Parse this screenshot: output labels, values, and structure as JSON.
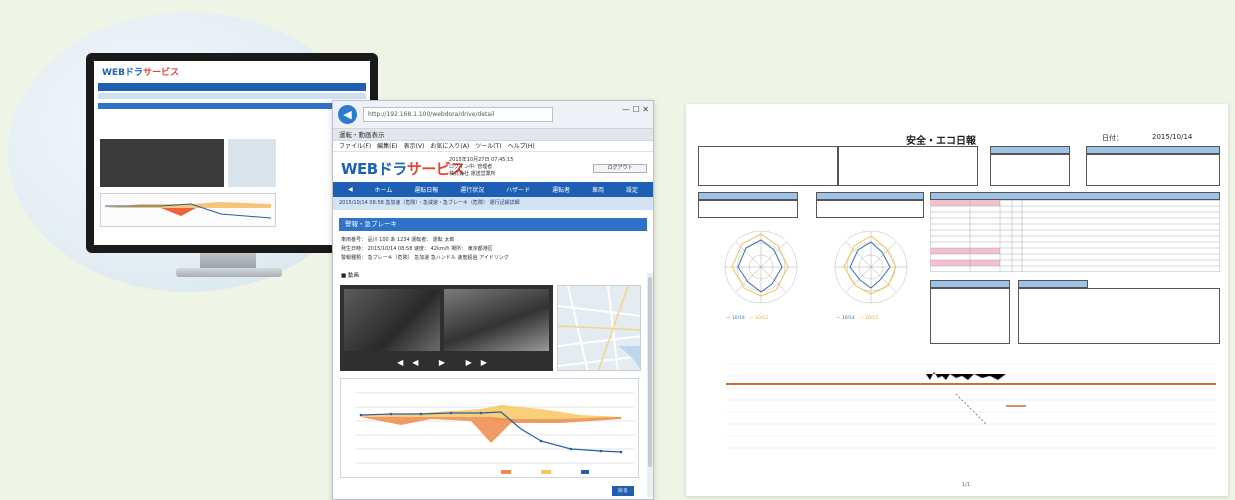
{
  "monitor": {
    "logo_main": "WEBドラ",
    "logo_accent": "サービス"
  },
  "browser": {
    "url": "http://192.168.1.100/webdora/drive/detail",
    "window_controls": "— ☐ ✕",
    "tab_title": "運転・動画表示",
    "menu": [
      "ファイル(F)",
      "編集(E)",
      "表示(V)",
      "お気に入り(A)",
      "ツール(T)",
      "ヘルプ(H)"
    ],
    "logo_main": "WEBドラ",
    "logo_accent": "サービス",
    "header_info": [
      "2015年10月27日 07:45:15",
      "ログイン中: 管理者",
      "株式会社 運送営業所"
    ],
    "header_button": "ログアウト",
    "nav": [
      "◀",
      "ホーム",
      "運転日報",
      "運行状況",
      "ハザード",
      "運転者",
      "車両",
      "設定"
    ],
    "breadcrumb": "2015/10/14 08:58  急加速（危険）・急減速・急ブレーキ（危険） 運行記録詳細",
    "section_title": "警報・急ブレーキ",
    "info_lines": [
      "車両番号： 品川 100 あ 1234      運転者： 運転 太郎",
      "発生日時： 2015/10/14 08:58      速度： 42km/h      場所： 東京都港区",
      "警報種類： 急ブレーキ（危険）  急加速  急ハンドル  速度超過  アイドリング"
    ],
    "video_section_label": "■ 動画",
    "video_controls": "◀◀ ▶ ▶▶",
    "fab_label": "戻る"
  },
  "report": {
    "title": "安全・エコ日報",
    "date_label": "日付：",
    "date": "2015/10/14",
    "legend1": [
      "— 10/14",
      "— 10/12"
    ],
    "legend2": [
      "— 10/14",
      "— 10/12"
    ],
    "footer": "1/1"
  }
}
